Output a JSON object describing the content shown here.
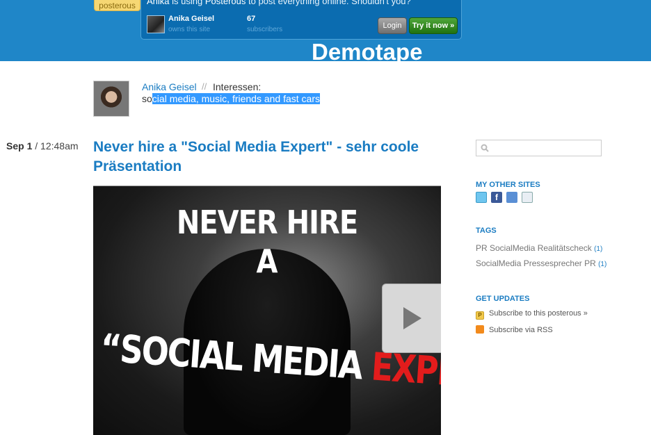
{
  "topbar": {
    "posterous_label": "posterous",
    "notice_prefix": "Anika",
    "notice_middle": " is using ",
    "notice_brand": "Posterous",
    "notice_suffix": " to post everything online. Shouldn't you?",
    "owner_name": "Anika Geisel",
    "owner_sub": "owns this site",
    "subscriber_count": "67",
    "subscriber_label": "subscribers",
    "login_label": "Login",
    "try_label": "Try it now »"
  },
  "site": {
    "title": "Demotape"
  },
  "profile": {
    "name": "Anika Geisel",
    "separator": "//",
    "label": "Interessen:",
    "interests_plain": "so",
    "interests_selected": "cial media, music, friends and fast cars"
  },
  "post": {
    "date_day": "Sep 1",
    "date_sep": " / ",
    "time": "12:48am",
    "title": "Never hire a \"Social Media Expert\" - sehr coole Präsentation",
    "slide": {
      "line1": "NEVER HIRE",
      "line2": "A",
      "line3_open": "“SOCIAL MEDIA ",
      "line3_red": "EXPERT",
      "line3_close": "”"
    }
  },
  "sidebar": {
    "search_placeholder": "",
    "my_other_sites_heading": "MY OTHER SITES",
    "social_icons": [
      "twitter-icon",
      "facebook-icon",
      "friendfeed-icon",
      "blog-icon"
    ],
    "tags_heading": "TAGS",
    "tags": [
      {
        "label": "PR SocialMedia Realitätscheck",
        "count": "(1)"
      },
      {
        "label": "SocialMedia Pressesprecher PR",
        "count": "(1)"
      }
    ],
    "updates_heading": "GET UPDATES",
    "updates": [
      {
        "label": "Subscribe to this posterous »",
        "icon": "posterous-icon"
      },
      {
        "label": "Subscribe via RSS",
        "icon": "rss-icon"
      }
    ]
  },
  "colors": {
    "header_blue": "#1f86c8",
    "link_blue": "#1a7cc2",
    "try_green": "#2e8b1e",
    "expert_red": "#e21c1c"
  }
}
